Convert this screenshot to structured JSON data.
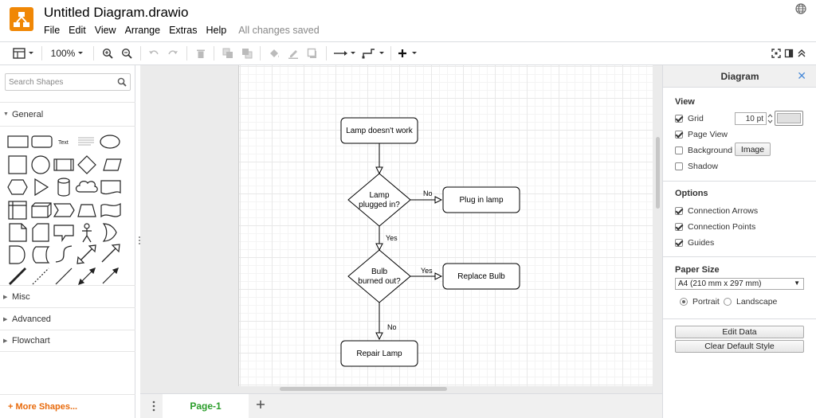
{
  "header": {
    "title": "Untitled Diagram.drawio",
    "menus": [
      "File",
      "Edit",
      "View",
      "Arrange",
      "Extras",
      "Help"
    ],
    "save_status": "All changes saved"
  },
  "toolbar": {
    "zoom": "100%"
  },
  "left_panel": {
    "search_placeholder": "Search Shapes",
    "sections": {
      "general": "General",
      "misc": "Misc",
      "advanced": "Advanced",
      "flowchart": "Flowchart"
    },
    "shape_text_label": "Text",
    "more_shapes": "+ More Shapes..."
  },
  "diagram": {
    "nodes": {
      "start": "Lamp doesn't work",
      "plugged_1": "Lamp",
      "plugged_2": "plugged in?",
      "plug_in": "Plug in lamp",
      "bulb_1": "Bulb",
      "bulb_2": "burned out?",
      "replace": "Replace Bulb",
      "repair": "Repair Lamp"
    },
    "edges": {
      "no1": "No",
      "yes1": "Yes",
      "yes2": "Yes",
      "no2": "No"
    }
  },
  "pages": {
    "tab1": "Page-1"
  },
  "right_panel": {
    "title": "Diagram",
    "view_title": "View",
    "grid_label": "Grid",
    "grid_size": "10 pt",
    "page_view_label": "Page View",
    "background_label": "Background",
    "image_button": "Image",
    "shadow_label": "Shadow",
    "options_title": "Options",
    "connection_arrows": "Connection Arrows",
    "connection_points": "Connection Points",
    "guides": "Guides",
    "paper_title": "Paper Size",
    "paper_value": "A4 (210 mm x 297 mm)",
    "portrait": "Portrait",
    "landscape": "Landscape",
    "edit_data": "Edit Data",
    "clear_style": "Clear Default Style"
  },
  "colors": {
    "logo": "#f08705",
    "accent": "#4b8bd8",
    "page_tab": "#2a9d2a",
    "more_shapes": "#e86a0b"
  }
}
